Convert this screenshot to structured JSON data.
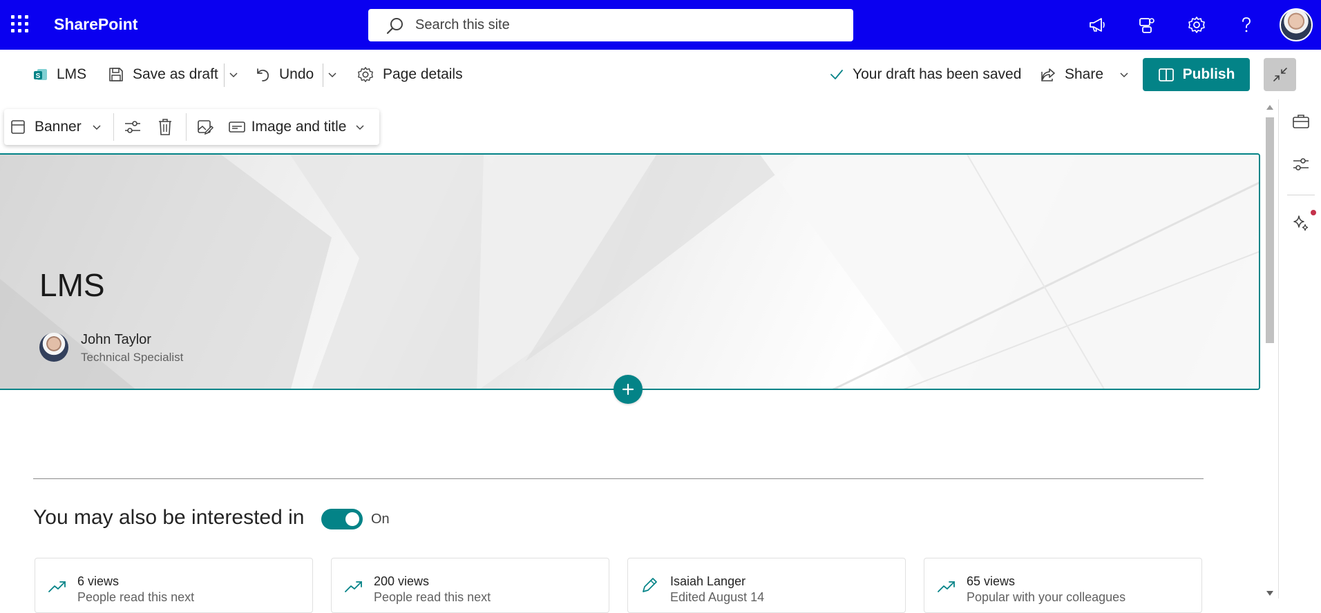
{
  "suite": {
    "brand": "SharePoint",
    "search_placeholder": "Search this site"
  },
  "command_bar": {
    "site_name": "LMS",
    "save_draft": "Save as draft",
    "undo": "Undo",
    "page_details": "Page details",
    "draft_status": "Your draft has been saved",
    "share": "Share",
    "publish": "Publish"
  },
  "webpart_toolbar": {
    "layout": "Banner",
    "title_layout": "Image and title"
  },
  "banner": {
    "title": "LMS",
    "author_name": "John Taylor",
    "author_role": "Technical Specialist"
  },
  "related": {
    "title": "You may also be interested in",
    "toggle_label": "On",
    "cards": [
      {
        "title": "6 views",
        "subtitle": "People read this next",
        "icon": "trending-icon"
      },
      {
        "title": "200 views",
        "subtitle": "People read this next",
        "icon": "trending-icon"
      },
      {
        "title": "Isaiah Langer",
        "subtitle": "Edited August 14",
        "icon": "edit-icon"
      },
      {
        "title": "65 views",
        "subtitle": "Popular with your colleagues",
        "icon": "trending-icon"
      }
    ]
  },
  "colors": {
    "suite_bar": "#0a00f0",
    "accent": "#038387"
  }
}
